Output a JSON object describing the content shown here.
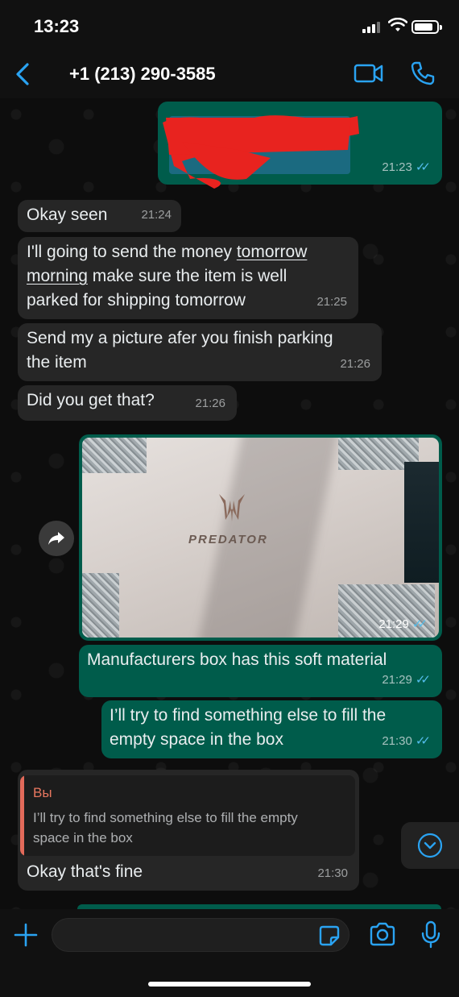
{
  "status_bar": {
    "time": "13:23"
  },
  "header": {
    "contact": "+1 (213) 290-3585"
  },
  "messages": [
    {
      "time": "21:23"
    },
    {
      "text": "Okay seen",
      "time": "21:24"
    },
    {
      "line1_a": "I'll going to send the money ",
      "line1_b": "tomorrow",
      "line2_a": "morning",
      "line2_b": " make sure the item is well",
      "line3": "parked for shipping tomorrow",
      "time": "21:25"
    },
    {
      "line1": "Send my a picture afer you finish parking",
      "line2": "the item",
      "time": "21:26"
    },
    {
      "text": "Did you get that?",
      "time": "21:26"
    },
    {
      "image_text": "PREDATOR",
      "time": "21:29"
    },
    {
      "text": "Manufacturers box has this soft material",
      "time": "21:29"
    },
    {
      "line1": "I’ll try to find something else to fill the",
      "line2": "empty space in the box",
      "time": "21:30"
    },
    {
      "quote_author": "Вы",
      "quote_line1": "I’ll try to find something else to fill the empty",
      "quote_line2": "space in the box",
      "text": "Okay that's fine",
      "time": "21:30"
    }
  ],
  "ticks": "✓✓",
  "input": {
    "placeholder": ""
  },
  "colors": {
    "accent": "#2aa3f2",
    "outgoing": "#005c4b",
    "incoming": "#262626",
    "read_ticks": "#53bdeb",
    "quote_bar": "#e26a5a"
  }
}
